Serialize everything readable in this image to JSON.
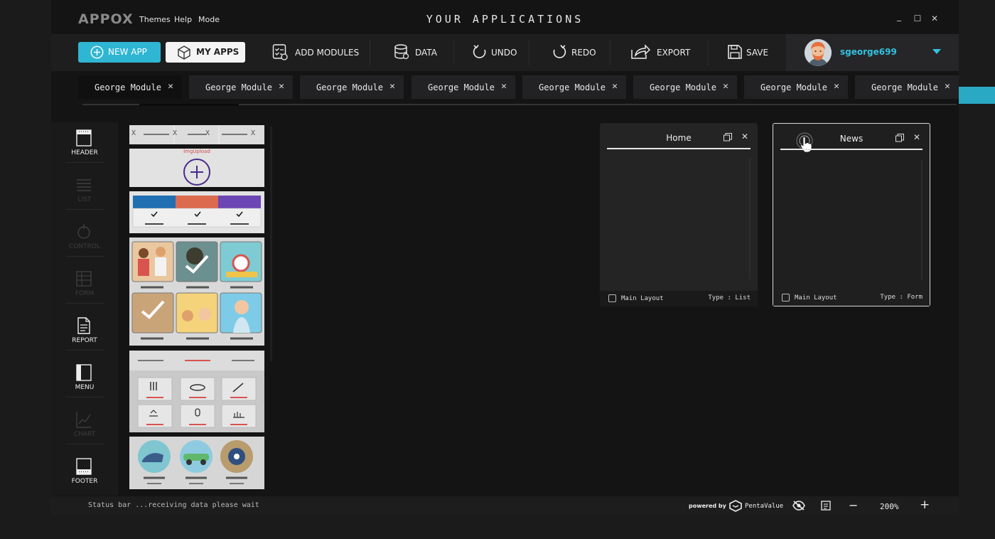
{
  "brand": {
    "logo": "APPOX"
  },
  "menu": [
    "Themes",
    "Help",
    "Mode"
  ],
  "window": {
    "title": "YOUR APPLICATIONS",
    "minimize": "_",
    "maximize": "☐",
    "close": "✕"
  },
  "toolbar": {
    "new_app": "NEW APP",
    "my_apps": "MY APPS",
    "add_modules": "ADD MODULES",
    "data": "DATA",
    "undo": "UNDO",
    "redo": "REDO",
    "export": "EXPORT",
    "save": "SAVE"
  },
  "user": {
    "username": "sgeorge699"
  },
  "tabs": [
    {
      "label": "George Module"
    },
    {
      "label": "George Module"
    },
    {
      "label": "George Module"
    },
    {
      "label": "George Module"
    },
    {
      "label": "George Module"
    },
    {
      "label": "George Module"
    },
    {
      "label": "George Module"
    },
    {
      "label": "George Module"
    }
  ],
  "tab_close": "✕",
  "sidebar": [
    {
      "label": "HEADER",
      "icon": "header-icon",
      "enabled": true
    },
    {
      "label": "LIST",
      "icon": "list-icon",
      "enabled": false
    },
    {
      "label": "CONTROL",
      "icon": "control-icon",
      "enabled": false
    },
    {
      "label": "FORM",
      "icon": "form-icon",
      "enabled": false
    },
    {
      "label": "REPORT",
      "icon": "report-icon",
      "enabled": true
    },
    {
      "label": "MENU",
      "icon": "menu-icon",
      "enabled": true
    },
    {
      "label": "CHART",
      "icon": "chart-icon",
      "enabled": false
    },
    {
      "label": "FOOTER",
      "icon": "footer-icon",
      "enabled": true
    }
  ],
  "templates": {
    "tab_close": "X",
    "img_upload_label": "ImgUpload",
    "color_swatches": [
      "#1f6fb2",
      "#dc6a4f",
      "#6b46b4"
    ]
  },
  "windows": [
    {
      "title": "Home",
      "footer_label": "Main Layout",
      "type_label": "Type : List"
    },
    {
      "title": "News",
      "footer_label": "Main Layout",
      "type_label": "Type : Form"
    }
  ],
  "status": {
    "text": "Status bar ...receiving data please wait",
    "powered_by": "powered by",
    "vendor": "PentaValue",
    "zoom": "200%",
    "zoom_out": "−",
    "zoom_in": "+"
  },
  "colors": {
    "accent": "#2fb6d3",
    "username": "#33c2e0",
    "background": "#141414"
  }
}
